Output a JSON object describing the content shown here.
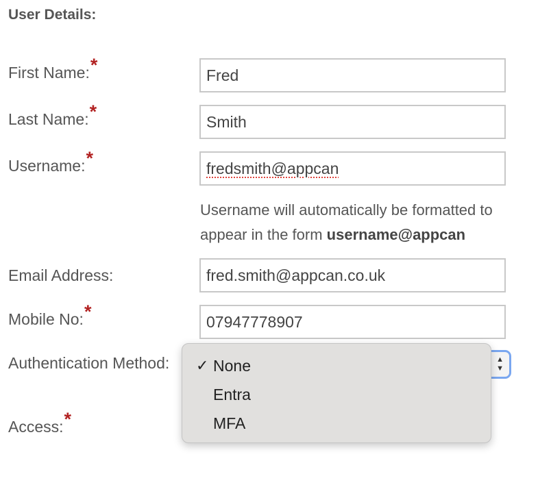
{
  "section_title": "User Details:",
  "required_marker": "*",
  "fields": {
    "first_name": {
      "label": "First Name:",
      "value": "Fred"
    },
    "last_name": {
      "label": "Last Name:",
      "value": "Smith"
    },
    "username": {
      "label": "Username:",
      "value": "fredsmith@appcan"
    },
    "email": {
      "label": "Email Address:",
      "value": "fred.smith@appcan.co.uk"
    },
    "mobile": {
      "label": "Mobile No:",
      "value": "07947778907"
    }
  },
  "username_hint": {
    "text": "Username will automatically be formatted to appear in the form ",
    "bold": "username@appcan"
  },
  "auth_method": {
    "label": "Authentication Method:",
    "selected": "None",
    "check_glyph": "✓",
    "options": [
      "None",
      "Entra",
      "MFA"
    ]
  },
  "access": {
    "label": "Access:"
  }
}
